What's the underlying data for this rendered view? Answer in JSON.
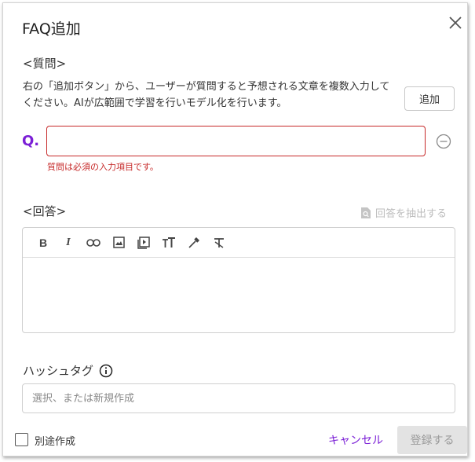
{
  "dialog": {
    "title": "FAQ追加",
    "question_section": {
      "heading": "<質問>",
      "description": "右の「追加ボタン」から、ユーザーが質問すると予想される文章を複数入力してください。AIが広範囲で学習を行いモデル化を行います。",
      "add_button": "追加",
      "prefix": "Q.",
      "input_value": "",
      "error": "質問は必須の入力項目です。"
    },
    "answer_section": {
      "heading": "<回答>",
      "extract_label": "回答を抽出する",
      "toolbar_icons": [
        "bold-icon",
        "italic-icon",
        "link-icon",
        "image-icon",
        "video-icon",
        "text-size-icon",
        "color-picker-icon",
        "clear-format-icon"
      ],
      "content": ""
    },
    "hashtag": {
      "label": "ハッシュタグ",
      "placeholder": "選択、または新規作成",
      "value": ""
    },
    "footer": {
      "separate_label": "別途作成",
      "separate_checked": false,
      "cancel": "キャンセル",
      "submit": "登録する"
    }
  },
  "colors": {
    "accent": "#7b1fd6",
    "error": "#c62828",
    "disabled_bg": "#e3e3e3"
  }
}
